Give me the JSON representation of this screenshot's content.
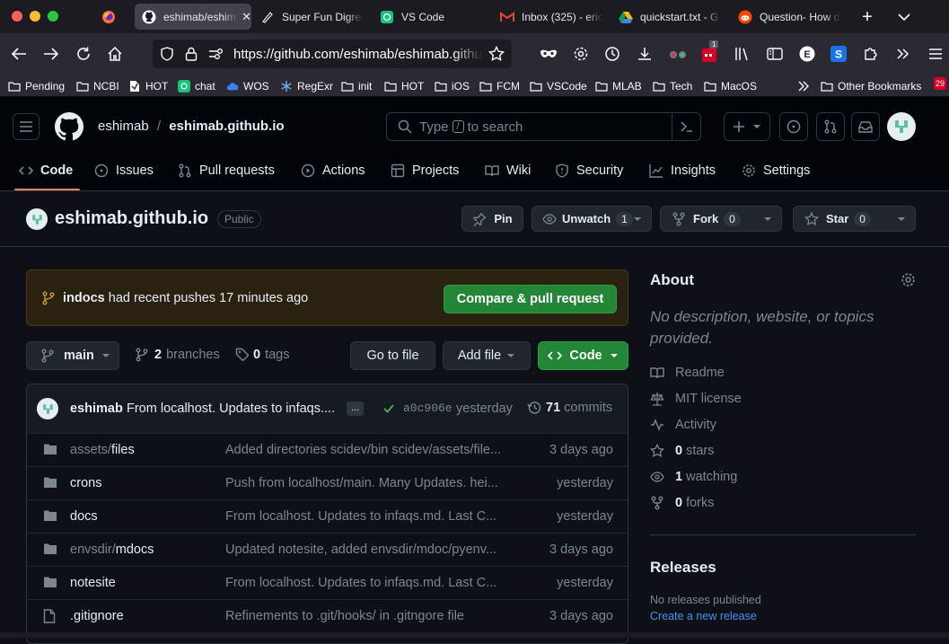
{
  "browser": {
    "tabs": [
      {
        "label": "",
        "icon": "firefox-icon"
      },
      {
        "label": "eshimab/eshim",
        "icon": "github-icon",
        "active": true
      },
      {
        "label": "Super Fun Digres",
        "icon": "document-icon"
      },
      {
        "label": "VS Code",
        "icon": "chatgpt-icon"
      },
      {
        "label": "Inbox (325) - eric",
        "icon": "gmail-icon"
      },
      {
        "label": "quickstart.txt - G",
        "icon": "drive-icon"
      },
      {
        "label": "Question- How d",
        "icon": "reddit-icon"
      }
    ],
    "url": "https://github.com/eshimab/eshimab.githut",
    "extension_badge": "1",
    "bookmarks": [
      "Pending",
      "NCBI",
      "HOT",
      "chat",
      "WOS",
      "RegExr",
      "init",
      "HOT",
      "iOS",
      "FCM",
      "VSCode",
      "MLAB",
      "Tech",
      "MacOS"
    ],
    "other_bookmarks": "Other Bookmarks",
    "bookmark_badge": "29"
  },
  "github": {
    "owner": "eshimab",
    "separator": "/",
    "repo": "eshimab.github.io",
    "search_placeholder_pre": "Type",
    "search_key": "/",
    "search_placeholder_post": "to search",
    "nav": [
      "Code",
      "Issues",
      "Pull requests",
      "Actions",
      "Projects",
      "Wiki",
      "Security",
      "Insights",
      "Settings"
    ],
    "visibility": "Public",
    "pin_label": "Pin",
    "watch_label": "Unwatch",
    "watch_count": "1",
    "fork_label": "Fork",
    "fork_count": "0",
    "star_label": "Star",
    "star_count": "0",
    "push_banner": {
      "branch": "indocs",
      "text": "had recent pushes 17 minutes ago",
      "button": "Compare & pull request"
    },
    "branch": "main",
    "branches_count": "2",
    "branches_label": "branches",
    "tags_count": "0",
    "tags_label": "tags",
    "goto_file": "Go to file",
    "add_file": "Add file",
    "code_button": "Code",
    "commit": {
      "author": "eshimab",
      "message": "From localhost. Updates to infaqs....",
      "ellipsis": "...",
      "sha": "a0c906e",
      "time": "yesterday",
      "commits_count": "71",
      "commits_label": "commits"
    },
    "files": [
      {
        "name_dim": "assets/",
        "name": "files",
        "message": "Added directories scidev/bin scidev/assets/file...",
        "date": "3 days ago",
        "type": "dir"
      },
      {
        "name_dim": "",
        "name": "crons",
        "message": "Push from localhost/main. Many Updates. hei...",
        "date": "yesterday",
        "type": "dir"
      },
      {
        "name_dim": "",
        "name": "docs",
        "message": "From localhost. Updates to infaqs.md. Last C...",
        "date": "yesterday",
        "type": "dir"
      },
      {
        "name_dim": "envsdir/",
        "name": "mdocs",
        "message": "Updated notesite, added envsdir/mdoc/pyenv...",
        "date": "3 days ago",
        "type": "dir"
      },
      {
        "name_dim": "",
        "name": "notesite",
        "message": "From localhost. Updates to infaqs.md. Last C...",
        "date": "yesterday",
        "type": "dir"
      },
      {
        "name_dim": "",
        "name": ".gitignore",
        "message": "Refinements to .git/hooks/ in .gitngore file",
        "date": "3 days ago",
        "type": "file"
      }
    ],
    "about": {
      "title": "About",
      "description": "No description, website, or topics provided.",
      "readme": "Readme",
      "license": "MIT license",
      "activity": "Activity",
      "stars_count": "0",
      "stars_label": "stars",
      "watching_count": "1",
      "watching_label": "watching",
      "forks_count": "0",
      "forks_label": "forks"
    },
    "releases": {
      "title": "Releases",
      "none": "No releases published",
      "create": "Create a new release"
    },
    "colors": {
      "bg": "#0d1117",
      "green": "#238636",
      "link": "#4493f8",
      "muted": "#7d8590",
      "accent": "#f78166"
    }
  }
}
